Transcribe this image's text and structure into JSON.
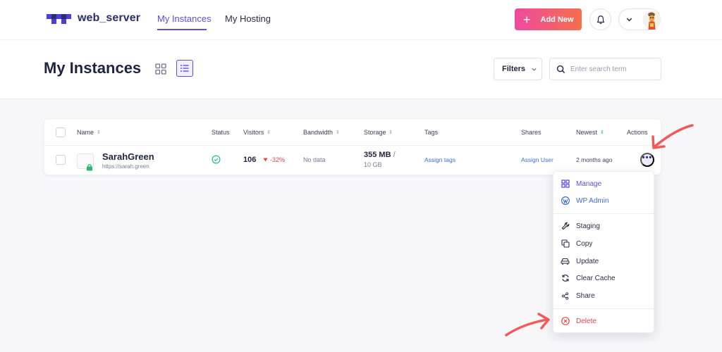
{
  "brand": {
    "name": "web_server"
  },
  "nav": {
    "items": [
      {
        "label": "My Instances",
        "active": true
      },
      {
        "label": "My Hosting",
        "active": false
      }
    ]
  },
  "topbar": {
    "add_new_label": "Add New"
  },
  "header": {
    "title": "My Instances",
    "filters_label": "Filters",
    "search_placeholder": "Enter search term"
  },
  "table": {
    "columns": [
      "Name",
      "Status",
      "Visitors",
      "Bandwidth",
      "Storage",
      "Tags",
      "Shares",
      "Newest",
      "Actions"
    ],
    "rows": [
      {
        "name": "SarahGreen",
        "url": "https://sarah.green",
        "status": "ok",
        "visitors": "106",
        "visitors_change": "-32%",
        "bandwidth": "No data",
        "storage_used": "355 MB",
        "storage_separator": "/",
        "storage_total": "10 GB",
        "tags": "Assign tags",
        "shares": "Assign User",
        "newest": "2 months ago"
      }
    ]
  },
  "actions_menu": {
    "items": [
      {
        "label": "Manage",
        "icon": "grid-icon"
      },
      {
        "label": "WP Admin",
        "icon": "wordpress-icon"
      },
      {
        "label": "Staging",
        "icon": "wrench-icon"
      },
      {
        "label": "Copy",
        "icon": "copy-icon"
      },
      {
        "label": "Update",
        "icon": "car-icon"
      },
      {
        "label": "Clear Cache",
        "icon": "refresh-icon"
      },
      {
        "label": "Share",
        "icon": "share-icon"
      },
      {
        "label": "Delete",
        "icon": "delete-circle-icon"
      }
    ]
  },
  "colors": {
    "accent": "#5b4fe0",
    "add_button_gradient_start": "#ee4a9e",
    "add_button_gradient_end": "#f46f4d",
    "link": "#3a6ed9",
    "danger": "#e04646",
    "success": "#2bb6a0",
    "annotation_arrow": "#f05a5a"
  }
}
